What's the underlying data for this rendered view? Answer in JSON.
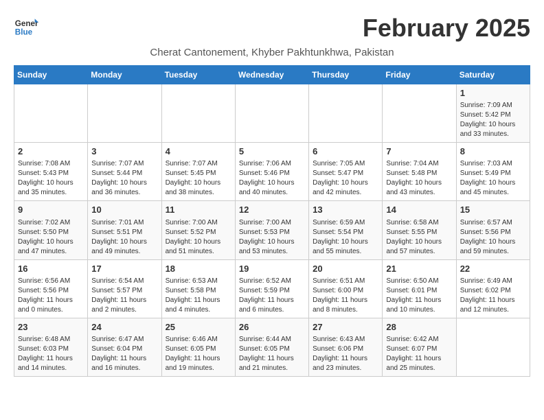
{
  "header": {
    "logo_line1": "General",
    "logo_line2": "Blue",
    "month_year": "February 2025",
    "location": "Cherat Cantonement, Khyber Pakhtunkhwa, Pakistan"
  },
  "weekdays": [
    "Sunday",
    "Monday",
    "Tuesday",
    "Wednesday",
    "Thursday",
    "Friday",
    "Saturday"
  ],
  "weeks": [
    [
      {
        "day": "",
        "info": ""
      },
      {
        "day": "",
        "info": ""
      },
      {
        "day": "",
        "info": ""
      },
      {
        "day": "",
        "info": ""
      },
      {
        "day": "",
        "info": ""
      },
      {
        "day": "",
        "info": ""
      },
      {
        "day": "1",
        "info": "Sunrise: 7:09 AM\nSunset: 5:42 PM\nDaylight: 10 hours and 33 minutes."
      }
    ],
    [
      {
        "day": "2",
        "info": "Sunrise: 7:08 AM\nSunset: 5:43 PM\nDaylight: 10 hours and 35 minutes."
      },
      {
        "day": "3",
        "info": "Sunrise: 7:07 AM\nSunset: 5:44 PM\nDaylight: 10 hours and 36 minutes."
      },
      {
        "day": "4",
        "info": "Sunrise: 7:07 AM\nSunset: 5:45 PM\nDaylight: 10 hours and 38 minutes."
      },
      {
        "day": "5",
        "info": "Sunrise: 7:06 AM\nSunset: 5:46 PM\nDaylight: 10 hours and 40 minutes."
      },
      {
        "day": "6",
        "info": "Sunrise: 7:05 AM\nSunset: 5:47 PM\nDaylight: 10 hours and 42 minutes."
      },
      {
        "day": "7",
        "info": "Sunrise: 7:04 AM\nSunset: 5:48 PM\nDaylight: 10 hours and 43 minutes."
      },
      {
        "day": "8",
        "info": "Sunrise: 7:03 AM\nSunset: 5:49 PM\nDaylight: 10 hours and 45 minutes."
      }
    ],
    [
      {
        "day": "9",
        "info": "Sunrise: 7:02 AM\nSunset: 5:50 PM\nDaylight: 10 hours and 47 minutes."
      },
      {
        "day": "10",
        "info": "Sunrise: 7:01 AM\nSunset: 5:51 PM\nDaylight: 10 hours and 49 minutes."
      },
      {
        "day": "11",
        "info": "Sunrise: 7:00 AM\nSunset: 5:52 PM\nDaylight: 10 hours and 51 minutes."
      },
      {
        "day": "12",
        "info": "Sunrise: 7:00 AM\nSunset: 5:53 PM\nDaylight: 10 hours and 53 minutes."
      },
      {
        "day": "13",
        "info": "Sunrise: 6:59 AM\nSunset: 5:54 PM\nDaylight: 10 hours and 55 minutes."
      },
      {
        "day": "14",
        "info": "Sunrise: 6:58 AM\nSunset: 5:55 PM\nDaylight: 10 hours and 57 minutes."
      },
      {
        "day": "15",
        "info": "Sunrise: 6:57 AM\nSunset: 5:56 PM\nDaylight: 10 hours and 59 minutes."
      }
    ],
    [
      {
        "day": "16",
        "info": "Sunrise: 6:56 AM\nSunset: 5:56 PM\nDaylight: 11 hours and 0 minutes."
      },
      {
        "day": "17",
        "info": "Sunrise: 6:54 AM\nSunset: 5:57 PM\nDaylight: 11 hours and 2 minutes."
      },
      {
        "day": "18",
        "info": "Sunrise: 6:53 AM\nSunset: 5:58 PM\nDaylight: 11 hours and 4 minutes."
      },
      {
        "day": "19",
        "info": "Sunrise: 6:52 AM\nSunset: 5:59 PM\nDaylight: 11 hours and 6 minutes."
      },
      {
        "day": "20",
        "info": "Sunrise: 6:51 AM\nSunset: 6:00 PM\nDaylight: 11 hours and 8 minutes."
      },
      {
        "day": "21",
        "info": "Sunrise: 6:50 AM\nSunset: 6:01 PM\nDaylight: 11 hours and 10 minutes."
      },
      {
        "day": "22",
        "info": "Sunrise: 6:49 AM\nSunset: 6:02 PM\nDaylight: 11 hours and 12 minutes."
      }
    ],
    [
      {
        "day": "23",
        "info": "Sunrise: 6:48 AM\nSunset: 6:03 PM\nDaylight: 11 hours and 14 minutes."
      },
      {
        "day": "24",
        "info": "Sunrise: 6:47 AM\nSunset: 6:04 PM\nDaylight: 11 hours and 16 minutes."
      },
      {
        "day": "25",
        "info": "Sunrise: 6:46 AM\nSunset: 6:05 PM\nDaylight: 11 hours and 19 minutes."
      },
      {
        "day": "26",
        "info": "Sunrise: 6:44 AM\nSunset: 6:05 PM\nDaylight: 11 hours and 21 minutes."
      },
      {
        "day": "27",
        "info": "Sunrise: 6:43 AM\nSunset: 6:06 PM\nDaylight: 11 hours and 23 minutes."
      },
      {
        "day": "28",
        "info": "Sunrise: 6:42 AM\nSunset: 6:07 PM\nDaylight: 11 hours and 25 minutes."
      },
      {
        "day": "",
        "info": ""
      }
    ]
  ]
}
